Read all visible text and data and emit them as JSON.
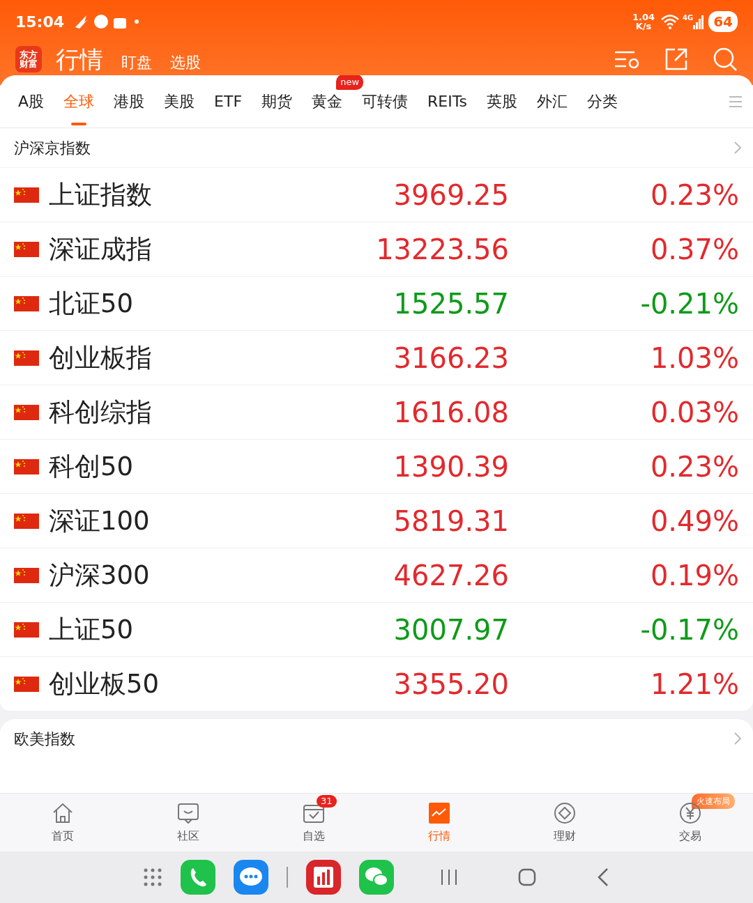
{
  "status_bar": {
    "time": "15:04",
    "speed": "1.04",
    "speed_unit": "K/s",
    "network": "4G",
    "battery": "64"
  },
  "header": {
    "logo_lines": [
      "东方",
      "财富"
    ],
    "title": "行情",
    "links": [
      "盯盘",
      "选股"
    ]
  },
  "tabs": [
    {
      "label": "A股",
      "selected": false
    },
    {
      "label": "全球",
      "selected": true
    },
    {
      "label": "港股",
      "selected": false
    },
    {
      "label": "美股",
      "selected": false
    },
    {
      "label": "ETF",
      "selected": false
    },
    {
      "label": "期货",
      "selected": false
    },
    {
      "label": "黄金",
      "selected": false,
      "badge": "new"
    },
    {
      "label": "可转债",
      "selected": false
    },
    {
      "label": "REITs",
      "selected": false
    },
    {
      "label": "英股",
      "selected": false
    },
    {
      "label": "外汇",
      "selected": false
    },
    {
      "label": "分类",
      "selected": false
    }
  ],
  "sections": [
    {
      "title": "沪深京指数",
      "rows": [
        {
          "kind": "cn",
          "name": "上证指数",
          "price": "3969.25",
          "change": "0.23%",
          "color": "#e2292d"
        },
        {
          "kind": "cn",
          "name": "深证成指",
          "price": "13223.56",
          "change": "0.37%",
          "color": "#e2292d"
        },
        {
          "kind": "cn",
          "name": "北证50",
          "price": "1525.57",
          "change": "-0.21%",
          "color": "#0f9a1a"
        },
        {
          "kind": "cn",
          "name": "创业板指",
          "price": "3166.23",
          "change": "1.03%",
          "color": "#e2292d"
        },
        {
          "kind": "cn",
          "name": "科创综指",
          "price": "1616.08",
          "change": "0.03%",
          "color": "#e2292d"
        },
        {
          "kind": "cn",
          "name": "科创50",
          "price": "1390.39",
          "change": "0.23%",
          "color": "#e2292d"
        },
        {
          "kind": "cn",
          "name": "深证100",
          "price": "5819.31",
          "change": "0.49%",
          "color": "#e2292d"
        },
        {
          "kind": "cn",
          "name": "沪深300",
          "price": "4627.26",
          "change": "0.19%",
          "color": "#e2292d"
        },
        {
          "kind": "cn",
          "name": "上证50",
          "price": "3007.97",
          "change": "-0.17%",
          "color": "#0f9a1a"
        },
        {
          "kind": "cn",
          "name": "创业板50",
          "price": "3355.20",
          "change": "1.21%",
          "color": "#e2292d"
        }
      ]
    },
    {
      "title": "欧美指数"
    }
  ],
  "bottom_nav": [
    {
      "kind": "home",
      "label": "首页",
      "selected": false
    },
    {
      "kind": "chat",
      "label": "社区",
      "selected": false
    },
    {
      "kind": "check",
      "label": "自选",
      "selected": false,
      "badge": "31"
    },
    {
      "kind": "chart",
      "label": "行情",
      "selected": true
    },
    {
      "kind": "diamond",
      "label": "理财",
      "selected": false
    },
    {
      "kind": "yen",
      "label": "交易",
      "selected": false,
      "tag": "火速布局"
    }
  ]
}
